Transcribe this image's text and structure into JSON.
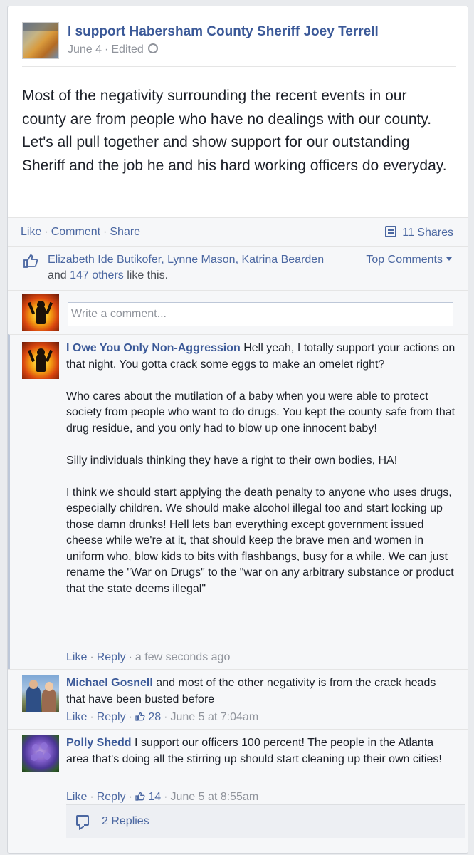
{
  "post": {
    "page_name": "I support Habersham County Sheriff Joey Terrell",
    "date": "June 4",
    "edited": "Edited",
    "text": "Most of the negativity surrounding the recent events in our county are from people who have no dealings with our county. Let's all pull together and show support for our outstanding Sheriff and the job he and his hard working officers do everyday."
  },
  "actions": {
    "like": "Like",
    "comment": "Comment",
    "share": "Share",
    "shares_count": "11 Shares"
  },
  "likes": {
    "names": "Elizabeth Ide Butikofer, Lynne Mason, Katrina Bearden",
    "and": "and",
    "others": "147 others",
    "suffix": "like this.",
    "top_comments": "Top Comments"
  },
  "write_comment": {
    "placeholder": "Write a comment..."
  },
  "comments": [
    {
      "name": "I Owe You Only Non-Aggression",
      "text": "Hell yeah, I totally support your actions on that night. You gotta crack some eggs to make an omelet right?\n\nWho cares about the mutilation of a baby when you were able to protect society from people who want to do drugs. You kept the county safe from that drug residue, and you only had to blow up one innocent baby!\n\nSilly individuals thinking they have a right to their own bodies, HA!\n\nI think we should start applying the death penalty to anyone who uses drugs, especially children. We should make alcohol illegal too and start locking up those damn drunks! Hell lets ban everything except government issued cheese while we're at it, that should keep the brave men and women in uniform who, blow kids to bits with flashbangs, busy for a while. We can just rename the \"War on Drugs\" to the \"war on any arbitrary substance or product that the state deems illegal\"",
      "like": "Like",
      "reply": "Reply",
      "time": "a few seconds ago"
    },
    {
      "name": "Michael Gosnell",
      "text": "and most of the other negativity is from the crack heads that have been busted before",
      "like": "Like",
      "reply": "Reply",
      "likes": "28",
      "time": "June 5 at 7:04am"
    },
    {
      "name": "Polly Shedd",
      "text": "I support our officers 100 percent! The people in the Atlanta area that's doing all the stirring up should start cleaning up their own cities!",
      "like": "Like",
      "reply": "Reply",
      "likes": "14",
      "time": "June 5 at 8:55am"
    }
  ],
  "replies": {
    "label": "2 Replies"
  },
  "colors": {
    "link": "#3b5998",
    "meta": "#90949c",
    "panel": "#f6f7f9"
  }
}
